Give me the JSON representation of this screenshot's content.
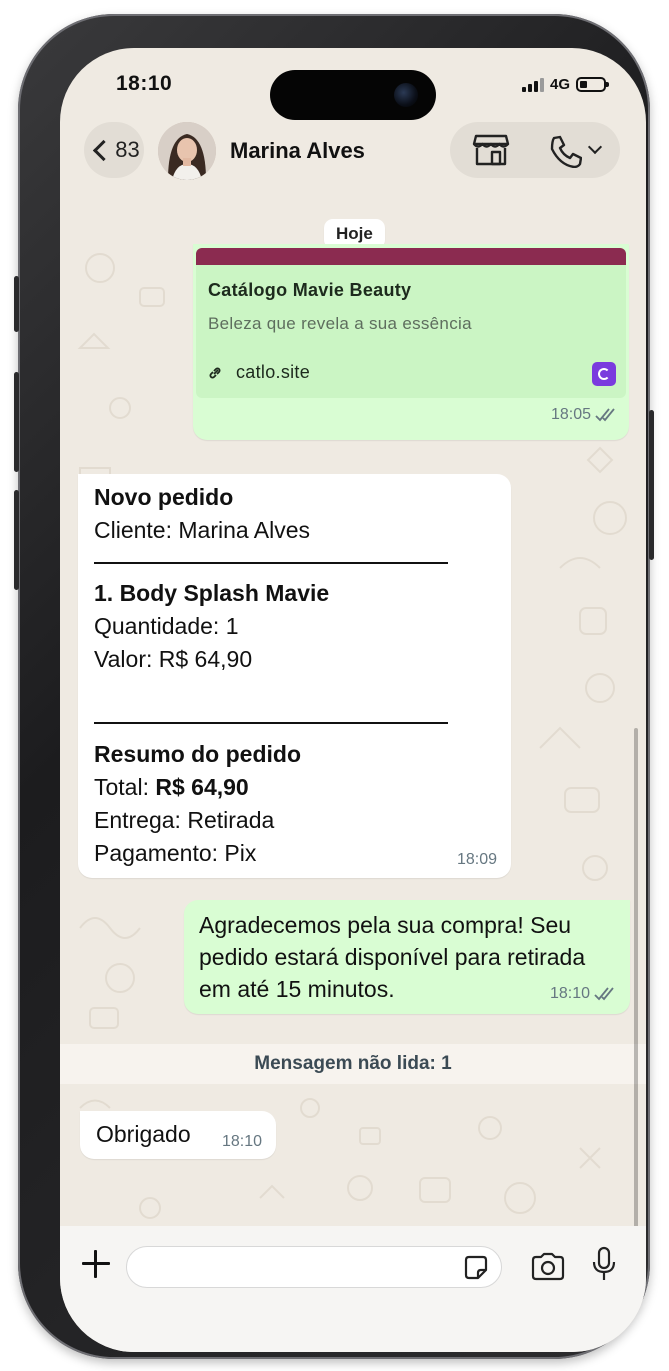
{
  "status_bar": {
    "time": "18:10",
    "network": "4G"
  },
  "header": {
    "back_count": "83",
    "contact_name": "Marina Alves"
  },
  "chat": {
    "date_chip": "Hoje",
    "link_message": {
      "title": "Catálogo Mavie Beauty",
      "description": "Beleza que revela a sua essência",
      "url": "catlo.site",
      "time": "18:05",
      "bar_color": "#8b2b50"
    },
    "order_message": {
      "heading": "Novo pedido",
      "client": "Cliente: Marina Alves",
      "item_name": "1. Body Splash Mavie",
      "item_quantity": "Quantidade: 1",
      "item_value": "Valor: R$ 64,90",
      "summary_heading": "Resumo do pedido",
      "total_label": "Total: ",
      "total_value": "R$ 64,90",
      "delivery": "Entrega: Retirada",
      "payment": "Pagamento: Pix",
      "time": "18:09"
    },
    "thanks_message": {
      "text": "Agradecemos  pela sua compra! Seu pedido estará disponível para retirada em até 15 minutos.",
      "time": "18:10"
    },
    "unread_banner": "Mensagem não lida: 1",
    "incoming_message": {
      "text": "Obrigado",
      "time": "18:10"
    }
  },
  "composer": {
    "value": "",
    "placeholder": ""
  },
  "colors": {
    "outgoing_bubble": "#d9fdd3",
    "incoming_bubble": "#ffffff",
    "wallpaper": "#efeae2",
    "read_ticks": "#667781"
  }
}
